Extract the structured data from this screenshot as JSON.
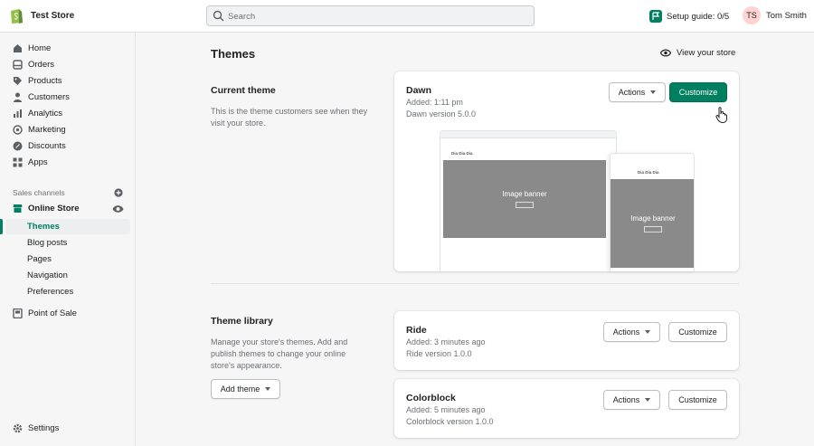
{
  "topbar": {
    "store_name": "Test Store",
    "search_placeholder": "Search",
    "setup_guide": "Setup guide: 0/5",
    "user_initials": "TS",
    "user_name": "Tom Smith"
  },
  "sidebar": {
    "items": [
      {
        "label": "Home",
        "icon": "home-icon"
      },
      {
        "label": "Orders",
        "icon": "orders-icon"
      },
      {
        "label": "Products",
        "icon": "tag-icon"
      },
      {
        "label": "Customers",
        "icon": "person-icon"
      },
      {
        "label": "Analytics",
        "icon": "analytics-icon"
      },
      {
        "label": "Marketing",
        "icon": "target-icon"
      },
      {
        "label": "Discounts",
        "icon": "discount-icon"
      },
      {
        "label": "Apps",
        "icon": "apps-icon"
      }
    ],
    "sales_channels_heading": "Sales channels",
    "online_store": "Online Store",
    "sub_items": [
      "Themes",
      "Blog posts",
      "Pages",
      "Navigation",
      "Preferences"
    ],
    "point_of_sale": "Point of Sale",
    "settings": "Settings"
  },
  "main": {
    "title": "Themes",
    "view_store": "View your store",
    "current": {
      "heading": "Current theme",
      "description": "This is the theme customers see when they visit your store.",
      "theme_name": "Dawn",
      "added": "Added: 1:11 pm",
      "version": "Dawn version 5.0.0",
      "actions_label": "Actions",
      "customize_label": "Customize",
      "preview": {
        "desktop_store": "Dia Dia Dia",
        "mobile_store": "Dia Dia Dia",
        "banner_label": "Image banner",
        "mobile_banner_label": "Image banner"
      }
    },
    "library": {
      "heading": "Theme library",
      "description": "Manage your store's themes. Add and publish themes to change your online store's appearance.",
      "add_theme": "Add theme",
      "themes": [
        {
          "name": "Ride",
          "added": "Added: 3 minutes ago",
          "version": "Ride version 1.0.0",
          "actions": "Actions",
          "customize": "Customize"
        },
        {
          "name": "Colorblock",
          "added": "Added: 5 minutes ago",
          "version": "Colorblock version 1.0.0",
          "actions": "Actions",
          "customize": "Customize"
        }
      ]
    }
  },
  "colors": {
    "primary": "#008060",
    "text": "#202223",
    "subdued": "#6d7175",
    "background": "#f6f6f7"
  }
}
